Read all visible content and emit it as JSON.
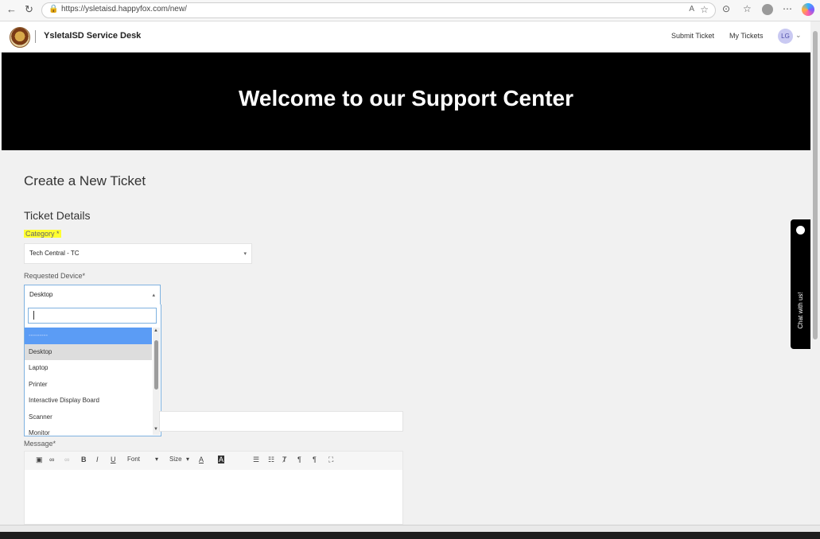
{
  "browser": {
    "url": "https://ysletaisd.happyfox.com/new/"
  },
  "header": {
    "site_title": "YsletaISD Service Desk",
    "links": [
      "Submit Ticket",
      "My Tickets"
    ],
    "user_initials": "LG"
  },
  "hero": {
    "title": "Welcome to our Support Center"
  },
  "form": {
    "page_title": "Create a New Ticket",
    "section_title": "Ticket Details",
    "category_label": "Category *",
    "category_value": "Tech Central - TC",
    "device_label": "Requested Device*",
    "device_value": "Desktop",
    "device_options": [
      "---------",
      "Desktop",
      "Laptop",
      "Printer",
      "Interactive Display Board",
      "Scanner",
      "Monitor"
    ],
    "message_label": "Message*",
    "toolbar": {
      "font_label": "Font",
      "size_label": "Size"
    }
  },
  "chat": {
    "label": "Chat with us!"
  },
  "colors": {
    "hero_bg": "#000000",
    "highlight": "#ffff30",
    "dropdown_active": "#5b9cf5"
  }
}
